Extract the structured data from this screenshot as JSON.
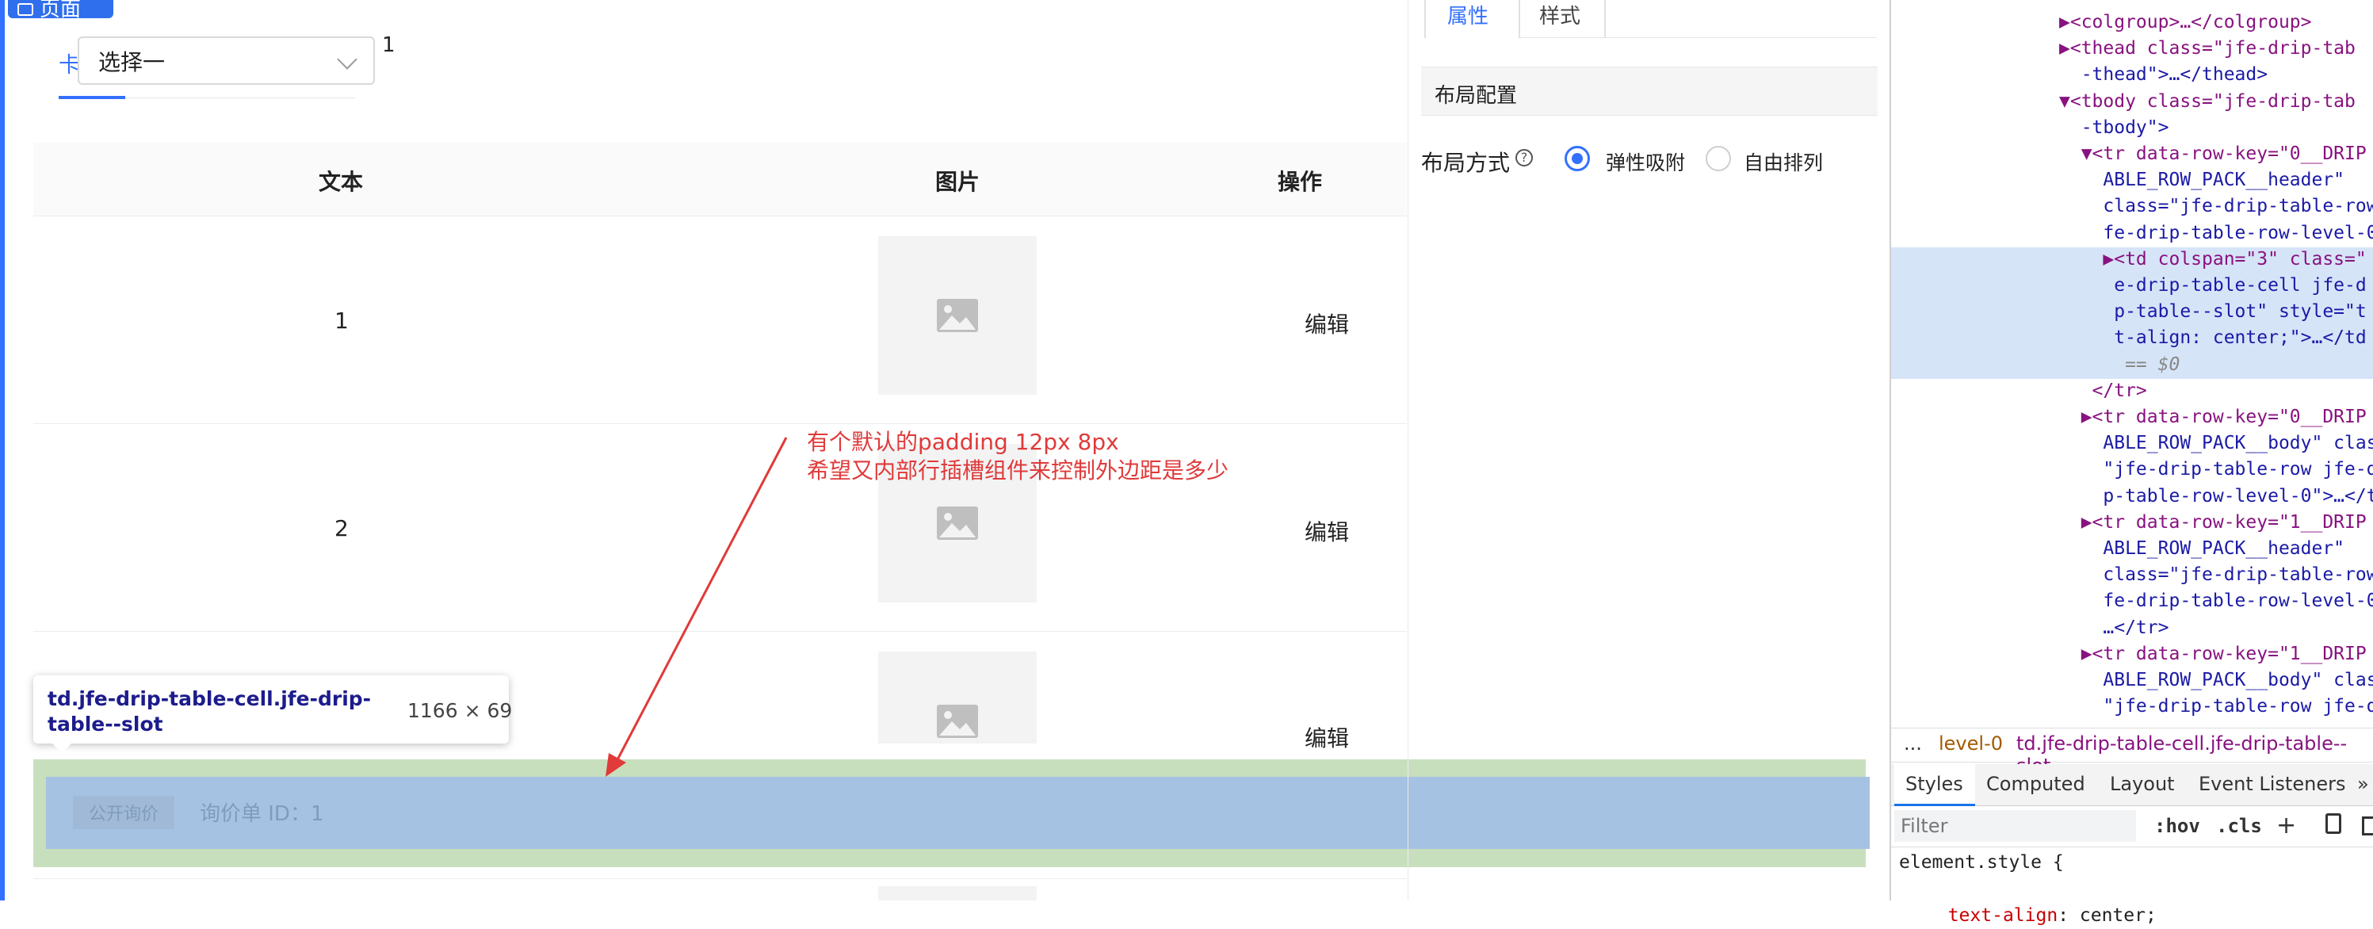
{
  "app": {
    "page_tag": "页面",
    "tab_label": "卡",
    "select": {
      "value": "选择一",
      "suffix": "1"
    },
    "table": {
      "headers": [
        "文本",
        "图片",
        "操作"
      ],
      "rows": [
        {
          "text": "1",
          "action": "编辑"
        },
        {
          "text": "2",
          "action": "编辑"
        },
        {
          "text": "",
          "action": "编辑"
        }
      ],
      "slot": {
        "badge": "公开询价",
        "id_text": "询价单 ID：1"
      }
    },
    "tooltip": {
      "title": "td.jfe-drip-table-cell.jfe-drip-table--slot",
      "size": "1166 × 69"
    },
    "annotation": {
      "line1": "有个默认的padding 12px 8px",
      "line2": "希望又内部行插槽组件来控制外边距是多少"
    }
  },
  "config_panel": {
    "tabs": [
      "属性",
      "样式"
    ],
    "section_title": "布局配置",
    "layout_label": "布局方式",
    "options": [
      {
        "label": "弹性吸附",
        "selected": true
      },
      {
        "label": "自由排列",
        "selected": false
      }
    ]
  },
  "devtools": {
    "dom_lines": [
      "▶<colgroup>…</colgroup>",
      "▶<thead class=\"jfe-drip-tab",
      "  -thead\">…</thead>",
      "▼<tbody class=\"jfe-drip-tab",
      "  -tbody\">",
      "  ▼<tr data-row-key=\"0__DRIP",
      "    ABLE_ROW_PACK__header\"",
      "    class=\"jfe-drip-table-row",
      "    fe-drip-table-row-level-0",
      "    ▶<td colspan=\"3\" class=\"",
      "     e-drip-table-cell jfe-d",
      "     p-table--slot\" style=\"t",
      "     t-align: center;\">…</td",
      "      == $0",
      "   </tr>",
      "  ▶<tr data-row-key=\"0__DRIP",
      "    ABLE_ROW_PACK__body\" clas",
      "    \"jfe-drip-table-row jfe-d",
      "    p-table-row-level-0\">…</t",
      "  ▶<tr data-row-key=\"1__DRIP",
      "    ABLE_ROW_PACK__header\"",
      "    class=\"jfe-drip-table-row",
      "    fe-drip-table-row-level-0",
      "    …</tr>",
      "  ▶<tr data-row-key=\"1__DRIP",
      "    ABLE_ROW_PACK__body\" clas",
      "    \"jfe-drip-table-row jfe-d"
    ],
    "breadcrumbs": [
      "...",
      "level-0",
      "td.jfe-drip-table-cell.jfe-drip-table--slot"
    ],
    "panel_tabs": [
      "Styles",
      "Computed",
      "Layout",
      "Event Listeners",
      "»"
    ],
    "filter_placeholder": "Filter",
    "hov": ":hov",
    "cls": ".cls",
    "styles": {
      "selector": "element.style {",
      "prop": "text-align",
      "value": "center;"
    }
  }
}
